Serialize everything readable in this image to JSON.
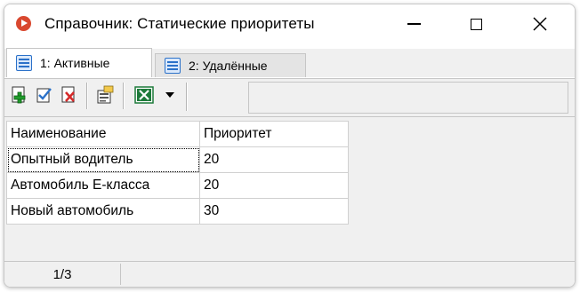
{
  "window": {
    "title": "Справочник: Статические приоритеты",
    "controls": {
      "minimize": "minimize",
      "maximize": "maximize",
      "close": "close"
    }
  },
  "tabs": [
    {
      "label": "1: Активные",
      "active": true,
      "icon": "list-icon"
    },
    {
      "label": "2: Удалённые",
      "active": false,
      "icon": "list-icon"
    }
  ],
  "toolbar": {
    "buttons": [
      {
        "name": "add-record-button",
        "icon": "add-icon"
      },
      {
        "name": "edit-record-button",
        "icon": "check-edit-icon"
      },
      {
        "name": "delete-record-button",
        "icon": "delete-icon"
      },
      {
        "name": "properties-button",
        "icon": "properties-icon"
      },
      {
        "name": "export-excel-button",
        "icon": "excel-icon"
      },
      {
        "name": "export-dropdown-button",
        "icon": "chevron-down-icon"
      }
    ]
  },
  "grid": {
    "columns": [
      "Наименование",
      "Приоритет"
    ],
    "rows": [
      [
        "Опытный водитель",
        "20"
      ],
      [
        "Автомобиль E-класса",
        "20"
      ],
      [
        "Новый автомобиль",
        "30"
      ]
    ]
  },
  "status": {
    "record_position": "1/3"
  },
  "colors": {
    "accent": "#2b71c9",
    "add": "#1f9d2b",
    "delete": "#d62a2a",
    "excel": "#1d7a3a"
  }
}
